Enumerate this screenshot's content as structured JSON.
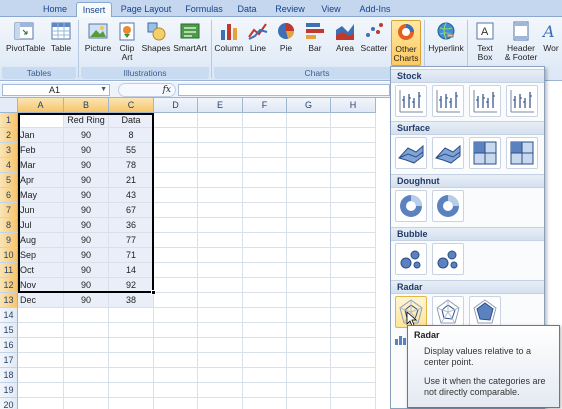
{
  "tabs": [
    {
      "label": "Home",
      "active": false
    },
    {
      "label": "Insert",
      "active": true
    },
    {
      "label": "Page Layout",
      "active": false
    },
    {
      "label": "Formulas",
      "active": false
    },
    {
      "label": "Data",
      "active": false
    },
    {
      "label": "Review",
      "active": false
    },
    {
      "label": "View",
      "active": false
    },
    {
      "label": "Add-Ins",
      "active": false
    }
  ],
  "ribbon": {
    "tables": {
      "label": "Tables",
      "pivottable": "PivotTable",
      "table": "Table"
    },
    "illustrations": {
      "label": "Illustrations",
      "picture": "Picture",
      "clipart_1": "Clip",
      "clipart_2": "Art",
      "shapes": "Shapes",
      "smartart": "SmartArt"
    },
    "charts": {
      "label": "Charts",
      "column": "Column",
      "line": "Line",
      "pie": "Pie",
      "bar": "Bar",
      "area": "Area",
      "scatter": "Scatter",
      "other_1": "Other",
      "other_2": "Charts"
    },
    "links": {
      "hyperlink": "Hyperlink"
    },
    "text": {
      "textbox_1": "Text",
      "textbox_2": "Box",
      "header_1": "Header",
      "header_2": "& Footer",
      "wordart": "Wor"
    }
  },
  "formula_bar": {
    "name_box": "A1",
    "fx": "fx",
    "formula": ""
  },
  "columns": [
    "A",
    "B",
    "C",
    "D",
    "E",
    "F",
    "G",
    "H"
  ],
  "rows": [
    "1",
    "2",
    "3",
    "4",
    "5",
    "6",
    "7",
    "8",
    "9",
    "10",
    "11",
    "12",
    "13",
    "14",
    "15",
    "16",
    "17",
    "18",
    "19",
    "20"
  ],
  "table": {
    "headers": [
      "",
      "Red Ring",
      "Data"
    ],
    "data": [
      [
        "Jan",
        "90",
        "8"
      ],
      [
        "Feb",
        "90",
        "55"
      ],
      [
        "Mar",
        "90",
        "78"
      ],
      [
        "Apr",
        "90",
        "21"
      ],
      [
        "May",
        "90",
        "43"
      ],
      [
        "Jun",
        "90",
        "67"
      ],
      [
        "Jul",
        "90",
        "36"
      ],
      [
        "Aug",
        "90",
        "77"
      ],
      [
        "Sep",
        "90",
        "71"
      ],
      [
        "Oct",
        "90",
        "14"
      ],
      [
        "Nov",
        "90",
        "92"
      ],
      [
        "Dec",
        "90",
        "38"
      ]
    ]
  },
  "gallery": {
    "sections": [
      "Stock",
      "Surface",
      "Doughnut",
      "Bubble",
      "Radar"
    ],
    "footer_icon": "all-chart-types-icon"
  },
  "tooltip": {
    "title": "Radar",
    "description": "Display values relative to a center point.",
    "hint": "Use it when the categories are not directly comparable."
  },
  "colors": {
    "accent": "#ffc95e",
    "ribbon": "#dbe7f5",
    "header_highlight": "#f7c56a"
  }
}
